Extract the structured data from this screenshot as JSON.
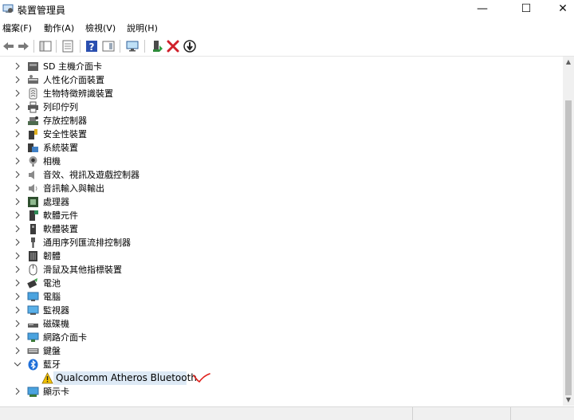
{
  "window": {
    "title": "裝置管理員",
    "minimize_glyph": "—",
    "maximize_glyph": "☐",
    "close_glyph": "✕"
  },
  "menu": [
    "檔案(F)",
    "動作(A)",
    "檢視(V)",
    "說明(H)"
  ],
  "toolbar": {
    "buttons": [
      "back-icon",
      "forward-icon",
      "show-hide-console-tree-icon",
      "properties-icon",
      "help-icon",
      "action-pane-icon",
      "monitor-icon",
      "update-driver-icon",
      "uninstall-icon",
      "disable-icon"
    ]
  },
  "tree": {
    "categories": [
      {
        "label": "SD 主機介面卡",
        "icon": "sd-host-icon"
      },
      {
        "label": "人性化介面裝置",
        "icon": "hid-icon"
      },
      {
        "label": "生物特徵辨識裝置",
        "icon": "biometric-icon"
      },
      {
        "label": "列印佇列",
        "icon": "printer-icon"
      },
      {
        "label": "存放控制器",
        "icon": "storage-controller-icon"
      },
      {
        "label": "安全性裝置",
        "icon": "security-device-icon"
      },
      {
        "label": "系統裝置",
        "icon": "system-device-icon"
      },
      {
        "label": "相機",
        "icon": "camera-icon"
      },
      {
        "label": "音效、視訊及遊戲控制器",
        "icon": "sound-icon"
      },
      {
        "label": "音訊輸入與輸出",
        "icon": "audio-io-icon"
      },
      {
        "label": "處理器",
        "icon": "processor-icon"
      },
      {
        "label": "軟體元件",
        "icon": "software-component-icon"
      },
      {
        "label": "軟體裝置",
        "icon": "software-device-icon"
      },
      {
        "label": "通用序列匯流排控制器",
        "icon": "usb-icon"
      },
      {
        "label": "韌體",
        "icon": "firmware-icon"
      },
      {
        "label": "滑鼠及其他指標裝置",
        "icon": "mouse-icon"
      },
      {
        "label": "電池",
        "icon": "battery-icon"
      },
      {
        "label": "電腦",
        "icon": "computer-icon"
      },
      {
        "label": "監視器",
        "icon": "monitor-icon"
      },
      {
        "label": "磁碟機",
        "icon": "disk-drive-icon"
      },
      {
        "label": "網路介面卡",
        "icon": "network-adapter-icon"
      },
      {
        "label": "鍵盤",
        "icon": "keyboard-icon"
      },
      {
        "label": "藍牙",
        "icon": "bluetooth-icon",
        "expanded": true
      },
      {
        "label": "Qualcomm Atheros Bluetooth",
        "icon": "warning-icon",
        "child": true,
        "selected": true
      },
      {
        "label": "顯示卡",
        "icon": "display-adapter-icon"
      }
    ]
  },
  "colors": {
    "selection": "#dde9f5",
    "annotation": "#e0201b",
    "bluetooth": "#1e6fd9"
  }
}
